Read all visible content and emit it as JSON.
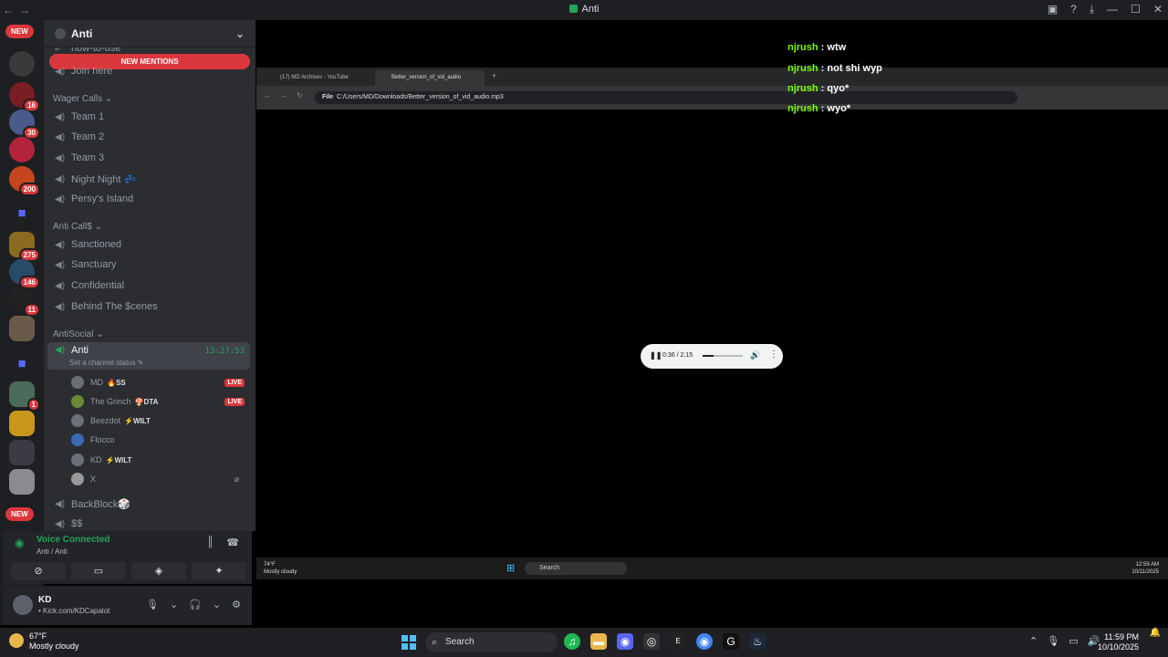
{
  "window": {
    "title": "Anti"
  },
  "rail": {
    "new_top": "NEW",
    "new_bottom": "NEW",
    "badges": [
      "16",
      "30",
      "200",
      "275",
      "146",
      "11",
      "1"
    ]
  },
  "guild": {
    "name": "Anti",
    "mentions": "NEW MENTIONS",
    "partial_top": "now-to-use"
  },
  "channels": {
    "join_here": "Join here",
    "cat_wager": "Wager Calls",
    "wager": [
      "Team 1",
      "Team 2",
      "Team 3",
      "Night Night 💤",
      "Persy's Island"
    ],
    "cat_anticall": "Anti Call$",
    "anticall": [
      "Sanctioned",
      "Sanctuary",
      "Confidential",
      "Behind The $cenes"
    ],
    "cat_antisocial": "AntiSocial",
    "active": {
      "name": "Anti",
      "timer": "13:27:53",
      "status": "Set a channel status ✎"
    },
    "members": [
      {
        "name": "MD",
        "tag": "🔥SS",
        "live": "LIVE"
      },
      {
        "name": "The Grinch",
        "tag": "🍄DTA",
        "live": "LIVE"
      },
      {
        "name": "Beezdot",
        "tag": "⚡WILT",
        "live": ""
      },
      {
        "name": "Flocco",
        "tag": "",
        "live": ""
      },
      {
        "name": "KD",
        "tag": "⚡WILT",
        "live": ""
      },
      {
        "name": "X",
        "tag": "",
        "live": ""
      }
    ],
    "backblock": "BackBlock🎲",
    "partial_bottom": "$$"
  },
  "voice": {
    "status": "Voice Connected",
    "location": "Anti / Anti"
  },
  "user": {
    "name": "KD",
    "status": "• Kick.com/KDCapalot"
  },
  "stream": {
    "tabs": [
      "(17) MD Archives - YouTube",
      "Better_version_of_vid_audio"
    ],
    "address_label": "File",
    "address": "C:/Users/MD/Downloads/Better_version_of_vid_audio.mp3",
    "chat": [
      {
        "user": "njrush",
        "msg": " : wtw"
      },
      {
        "user": "njrush",
        "msg": " : not shi wyp"
      },
      {
        "user": "njrush",
        "msg": " : qyo*"
      },
      {
        "user": "njrush",
        "msg": " : wyo*"
      }
    ],
    "player": {
      "time": "0:36 / 2:15",
      "progress": 0.27
    },
    "inner_weather": {
      "temp": "74°F",
      "cond": "Mostly cloudy"
    },
    "inner_search": "Search",
    "inner_clock": {
      "time": "12:59 AM",
      "date": "10/11/2025"
    }
  },
  "taskbar": {
    "weather": {
      "temp": "67°F",
      "cond": "Mostly cloudy"
    },
    "search": "Search",
    "clock": {
      "time": "11:59 PM",
      "date": "10/10/2025"
    }
  }
}
